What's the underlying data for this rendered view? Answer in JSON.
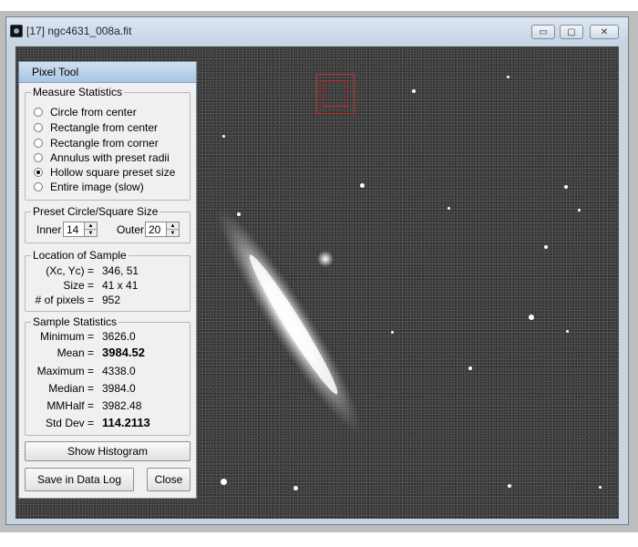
{
  "window": {
    "title": "[17] ngc4631_008a.fit",
    "minimize_symbol": "▭",
    "maximize_symbol": "▢",
    "close_symbol": "✕"
  },
  "pixel_tool": {
    "title": "Pixel Tool",
    "measure": {
      "legend": "Measure Statistics",
      "options": [
        {
          "label": "Circle from center",
          "selected": false
        },
        {
          "label": "Rectangle from center",
          "selected": false
        },
        {
          "label": "Rectangle from corner",
          "selected": false
        },
        {
          "label": "Annulus with preset radii",
          "selected": false
        },
        {
          "label": "Hollow square preset size",
          "selected": true
        },
        {
          "label": "Entire image (slow)",
          "selected": false
        }
      ]
    },
    "preset": {
      "legend": "Preset Circle/Square Size",
      "inner_label": "Inner",
      "inner_value": "14",
      "outer_label": "Outer",
      "outer_value": "20"
    },
    "location": {
      "legend": "Location of Sample",
      "xc_label": "(Xc, Yc) =",
      "xc_value": "346,  51",
      "size_label": "Size =",
      "size_value": "41  x  41",
      "pixels_label": "# of pixels =",
      "pixels_value": "952"
    },
    "stats": {
      "legend": "Sample Statistics",
      "rows": [
        {
          "label": "Minimum =",
          "value": "3626.0"
        },
        {
          "label": "Mean =",
          "value": "3984.52"
        },
        {
          "label": "Maximum =",
          "value": "4338.0"
        },
        {
          "label": "Median =",
          "value": "3984.0"
        },
        {
          "label": "MMHalf =",
          "value": "3982.48"
        },
        {
          "label": "Std Dev =",
          "value": "114.2113"
        }
      ]
    },
    "buttons": {
      "histogram": "Show Histogram",
      "save": "Save in Data Log",
      "close": "Close"
    }
  }
}
